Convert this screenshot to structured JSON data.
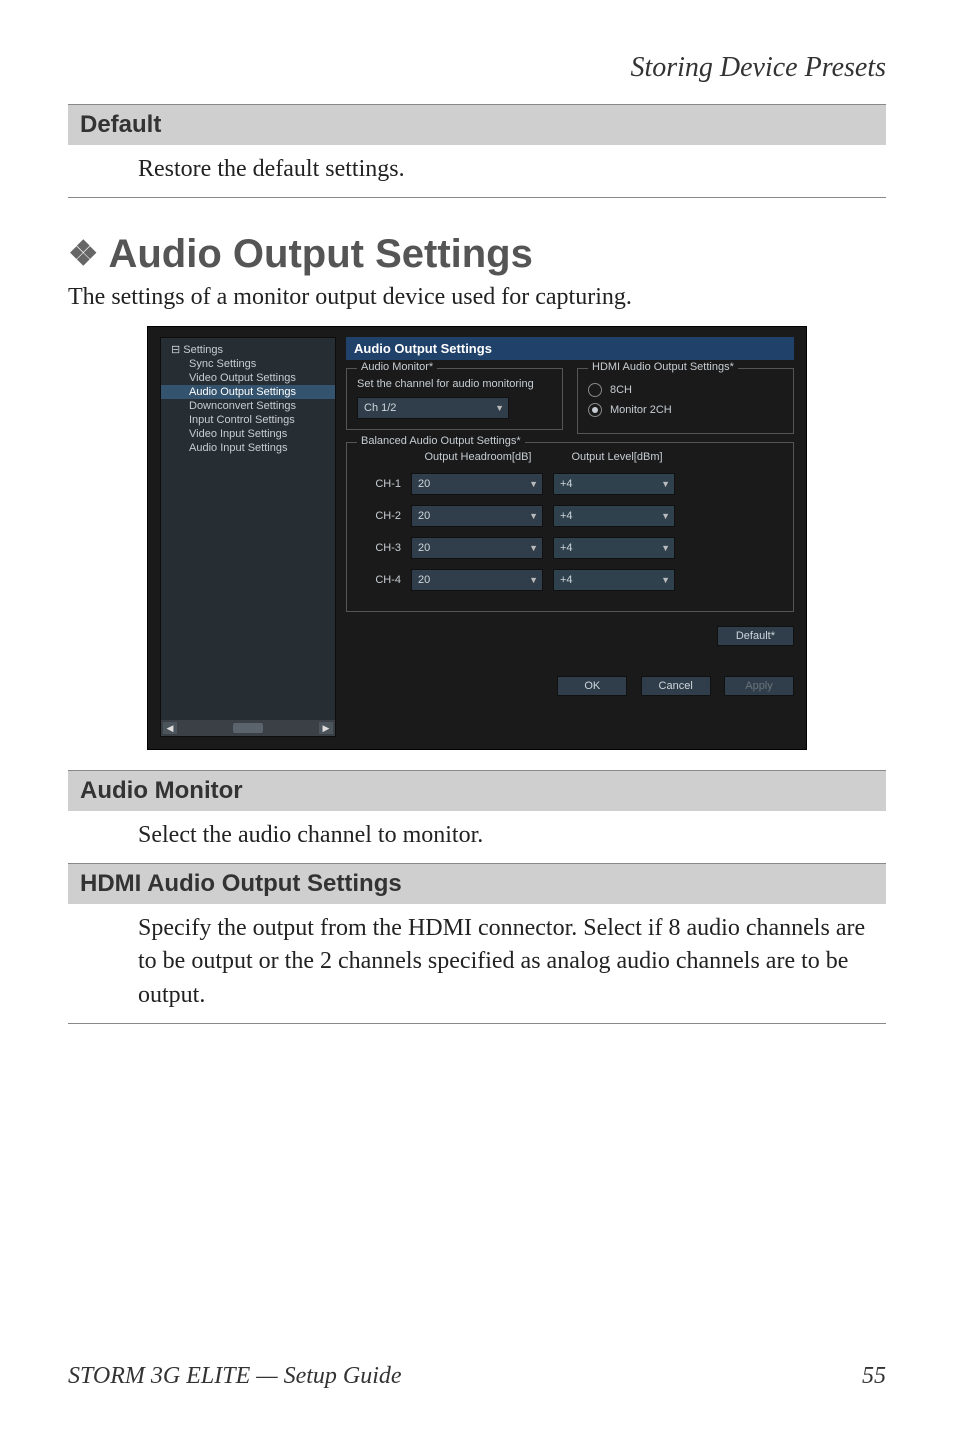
{
  "header": "Storing Device Presets",
  "default_table": {
    "head": "Default",
    "body": "Restore the default settings."
  },
  "section": {
    "diamond": "❖",
    "title": "Audio Output Settings",
    "intro": "The settings of a monitor output device used for capturing."
  },
  "tree": {
    "root": "Settings",
    "items": [
      "Sync Settings",
      "Video Output Settings",
      "Audio Output Settings",
      "Downconvert Settings",
      "Input Control Settings",
      "Video Input Settings",
      "Audio Input Settings"
    ],
    "selected_index": 2
  },
  "pane_title": "Audio Output Settings",
  "audio_monitor": {
    "group_title": "Audio Monitor*",
    "desc": "Set the channel for audio monitoring",
    "value": "Ch 1/2"
  },
  "hdmi": {
    "group_title": "HDMI Audio Output Settings*",
    "opt1": "8CH",
    "opt2": "Monitor 2CH"
  },
  "balanced": {
    "group_title": "Balanced Audio Output Settings*",
    "head1": "Output Headroom[dB]",
    "head2": "Output Level[dBm]",
    "rows": [
      {
        "label": "CH-1",
        "val1": "20",
        "val2": "+4"
      },
      {
        "label": "CH-2",
        "val1": "20",
        "val2": "+4"
      },
      {
        "label": "CH-3",
        "val1": "20",
        "val2": "+4"
      },
      {
        "label": "CH-4",
        "val1": "20",
        "val2": "+4"
      }
    ]
  },
  "buttons": {
    "default": "Default*",
    "ok": "OK",
    "cancel": "Cancel",
    "apply": "Apply"
  },
  "lower_tables": {
    "audio_monitor_head": "Audio Monitor",
    "audio_monitor_body": "Select the audio channel to monitor.",
    "hdmi_head": "HDMI Audio Output Settings",
    "hdmi_body": "Specify the output from the HDMI connector. Select if 8 audio channels are to be output or the 2 channels specified as analog audio channels are to be output."
  },
  "footer": {
    "left": "STORM 3G ELITE  —  Setup Guide",
    "right": "55"
  }
}
